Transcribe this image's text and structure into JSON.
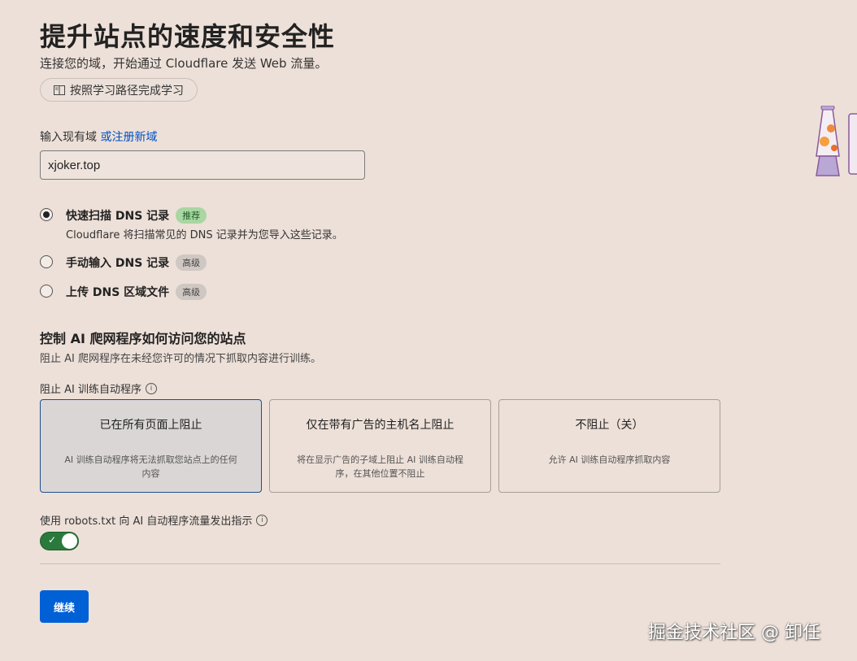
{
  "header": {
    "title": "提升站点的速度和安全性",
    "subtitle": "连接您的域，开始通过 Cloudflare 发送 Web 流量。",
    "learn_button": "按照学习路径完成学习"
  },
  "domain": {
    "label": "输入现有域",
    "register_link": "或注册新域",
    "value": "xjoker.top"
  },
  "options": [
    {
      "title": "快速扫描 DNS 记录",
      "badge": "推荐",
      "desc": "Cloudflare 将扫描常见的 DNS 记录并为您导入这些记录。",
      "checked": true
    },
    {
      "title": "手动输入 DNS 记录",
      "badge": "高级",
      "checked": false
    },
    {
      "title": "上传 DNS 区域文件",
      "badge": "高级",
      "checked": false
    }
  ],
  "ai": {
    "title": "控制 AI 爬网程序如何访问您的站点",
    "desc": "阻止 AI 爬网程序在未经您许可的情况下抓取内容进行训练。",
    "block_label": "阻止 AI 训练自动程序",
    "cards": [
      {
        "title": "已在所有页面上阻止",
        "desc": "AI 训练自动程序将无法抓取您站点上的任何内容",
        "selected": true
      },
      {
        "title": "仅在带有广告的主机名上阻止",
        "desc": "将在显示广告的子域上阻止 AI 训练自动程序，在其他位置不阻止",
        "selected": false
      },
      {
        "title": "不阻止（关）",
        "desc": "允许 AI 训练自动程序抓取内容",
        "selected": false
      }
    ],
    "robots_label": "使用 robots.txt 向 AI 自动程序流量发出指示",
    "robots_enabled": true
  },
  "continue_button": "继续",
  "watermark": "掘金技术社区 @ 卸任",
  "colors": {
    "accent": "#0060d6",
    "toggle_on": "#2b7a3d",
    "link": "#0051c3",
    "background": "#ede0d8"
  }
}
